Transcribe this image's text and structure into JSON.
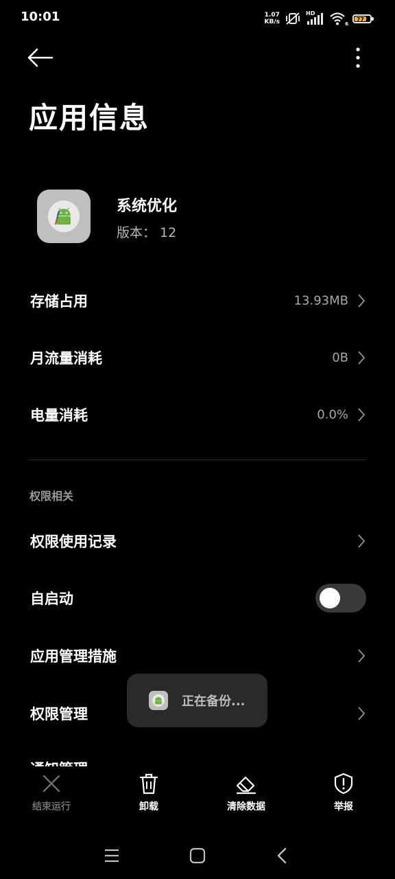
{
  "status_bar": {
    "time": "10:01",
    "net_speed_value": "1.07",
    "net_speed_unit": "KB/s",
    "hd_label": "HD",
    "wifi_badge": "6",
    "battery_level": "77"
  },
  "header": {
    "title": "应用信息"
  },
  "app": {
    "name": "系统优化",
    "version": "版本： 12"
  },
  "info_rows": [
    {
      "label": "存储占用",
      "value": "13.93MB"
    },
    {
      "label": "月流量消耗",
      "value": "0B"
    },
    {
      "label": "电量消耗",
      "value": "0.0%"
    }
  ],
  "permissions_section": {
    "title": "权限相关",
    "rows": [
      {
        "label": "权限使用记录"
      },
      {
        "label": "自启动",
        "toggle_on": false
      },
      {
        "label": "应用管理措施"
      },
      {
        "label": "权限管理"
      },
      {
        "label": "通知管理"
      }
    ]
  },
  "toast": {
    "text": "正在备份..."
  },
  "toolbar": {
    "force_stop_label": "结束运行",
    "uninstall_label": "卸载",
    "clear_data_label": "清除数据",
    "report_label": "举报"
  },
  "colors": {
    "background": "#000000",
    "battery": "#f4b43c",
    "toggle_track_off": "#3a3a3a",
    "toast_bg": "#2a2a2a"
  }
}
